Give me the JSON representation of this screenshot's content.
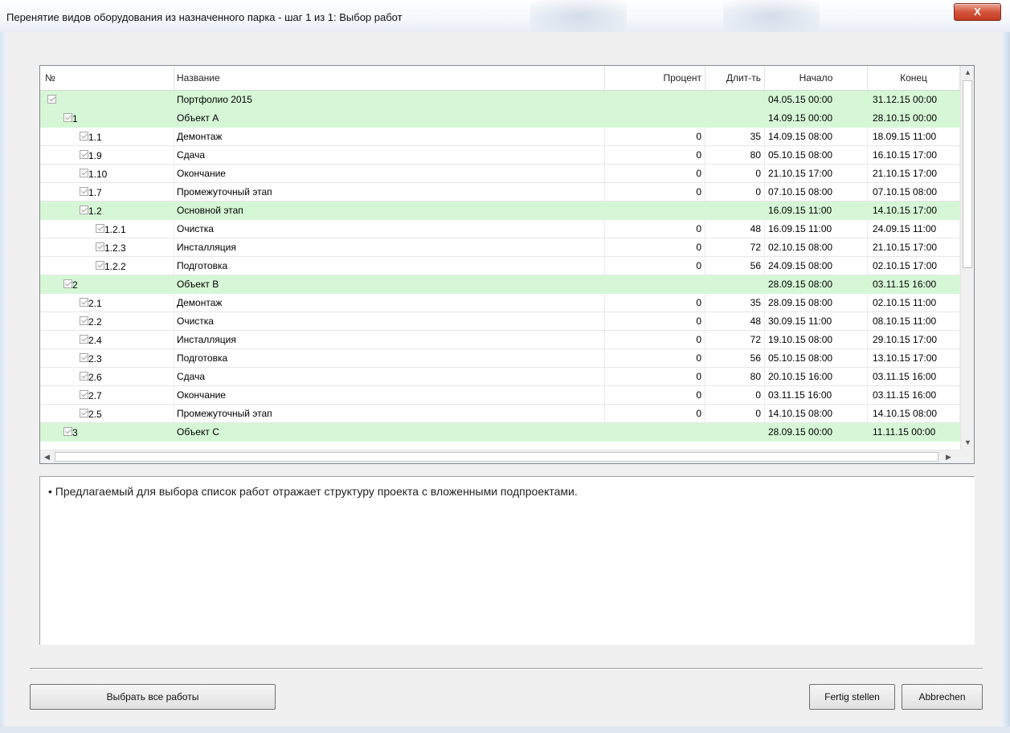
{
  "window": {
    "title": "Перенятие видов оборудования из назначенного парка - шаг 1 из 1: Выбор работ",
    "close_label": "X"
  },
  "grid": {
    "columns": {
      "no": "№",
      "name": "Название",
      "percent": "Процент",
      "duration": "Длит-ть",
      "start": "Начало",
      "end": "Конец"
    },
    "rows": [
      {
        "no": "",
        "name": "Портфолио 2015",
        "pct": "",
        "dur": "",
        "start": "04.05.15 00:00",
        "end": "31.12.15 00:00",
        "group": true,
        "level": 0
      },
      {
        "no": "1",
        "name": "Объект А",
        "pct": "",
        "dur": "",
        "start": "14.09.15 00:00",
        "end": "28.10.15 00:00",
        "group": true,
        "level": 1
      },
      {
        "no": "1.1",
        "name": "Демонтаж",
        "pct": "0",
        "dur": "35",
        "start": "14.09.15 08:00",
        "end": "18.09.15 11:00",
        "group": false,
        "level": 2
      },
      {
        "no": "1.9",
        "name": "Сдача",
        "pct": "0",
        "dur": "80",
        "start": "05.10.15 08:00",
        "end": "16.10.15 17:00",
        "group": false,
        "level": 2
      },
      {
        "no": "1.10",
        "name": "Окончание",
        "pct": "0",
        "dur": "0",
        "start": "21.10.15 17:00",
        "end": "21.10.15 17:00",
        "group": false,
        "level": 2
      },
      {
        "no": "1.7",
        "name": "Промежуточный этап",
        "pct": "0",
        "dur": "0",
        "start": "07.10.15 08:00",
        "end": "07.10.15 08:00",
        "group": false,
        "level": 2
      },
      {
        "no": "1.2",
        "name": "Основной этап",
        "pct": "",
        "dur": "",
        "start": "16.09.15 11:00",
        "end": "14.10.15 17:00",
        "group": true,
        "level": 2
      },
      {
        "no": "1.2.1",
        "name": "Очистка",
        "pct": "0",
        "dur": "48",
        "start": "16.09.15 11:00",
        "end": "24.09.15 11:00",
        "group": false,
        "level": 3
      },
      {
        "no": "1.2.3",
        "name": "Инсталляция",
        "pct": "0",
        "dur": "72",
        "start": "02.10.15 08:00",
        "end": "21.10.15 17:00",
        "group": false,
        "level": 3
      },
      {
        "no": "1.2.2",
        "name": "Подготовка",
        "pct": "0",
        "dur": "56",
        "start": "24.09.15 08:00",
        "end": "02.10.15 17:00",
        "group": false,
        "level": 3
      },
      {
        "no": "2",
        "name": "Объект В",
        "pct": "",
        "dur": "",
        "start": "28.09.15 08:00",
        "end": "03.11.15 16:00",
        "group": true,
        "level": 1
      },
      {
        "no": "2.1",
        "name": "Демонтаж",
        "pct": "0",
        "dur": "35",
        "start": "28.09.15 08:00",
        "end": "02.10.15 11:00",
        "group": false,
        "level": 2
      },
      {
        "no": "2.2",
        "name": "Очистка",
        "pct": "0",
        "dur": "48",
        "start": "30.09.15 11:00",
        "end": "08.10.15 11:00",
        "group": false,
        "level": 2
      },
      {
        "no": "2.4",
        "name": "Инсталляция",
        "pct": "0",
        "dur": "72",
        "start": "19.10.15 08:00",
        "end": "29.10.15 17:00",
        "group": false,
        "level": 2
      },
      {
        "no": "2.3",
        "name": "Подготовка",
        "pct": "0",
        "dur": "56",
        "start": "05.10.15 08:00",
        "end": "13.10.15 17:00",
        "group": false,
        "level": 2
      },
      {
        "no": "2.6",
        "name": "Сдача",
        "pct": "0",
        "dur": "80",
        "start": "20.10.15 16:00",
        "end": "03.11.15 16:00",
        "group": false,
        "level": 2
      },
      {
        "no": "2.7",
        "name": "Окончание",
        "pct": "0",
        "dur": "0",
        "start": "03.11.15 16:00",
        "end": "03.11.15 16:00",
        "group": false,
        "level": 2
      },
      {
        "no": "2.5",
        "name": "Промежуточный этап",
        "pct": "0",
        "dur": "0",
        "start": "14.10.15 08:00",
        "end": "14.10.15 08:00",
        "group": false,
        "level": 2
      },
      {
        "no": "3",
        "name": "Объект С",
        "pct": "",
        "dur": "",
        "start": "28.09.15 00:00",
        "end": "11.11.15 00:00",
        "group": true,
        "level": 1
      }
    ]
  },
  "info": {
    "text": "• Предлагаемый для выбора список работ отражает структуру проекта с вложенными подпроектами."
  },
  "buttons": {
    "select_all": "Выбрать все работы",
    "finish": "Fertig stellen",
    "cancel": "Abbrechen"
  },
  "scroll": {
    "up": "▲",
    "down": "▼",
    "left": "◀",
    "right": "▶"
  }
}
